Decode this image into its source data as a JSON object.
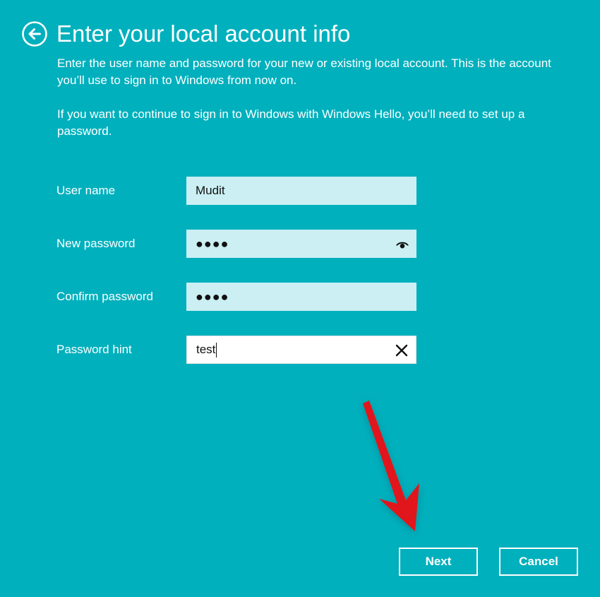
{
  "page": {
    "title": "Enter your local account info",
    "description": "Enter the user name and password for your new or existing local account. This is the account you’ll use to sign in to Windows from now on.",
    "hello_note": "If you want to continue to sign in to Windows with Windows Hello, you’ll need to set up a password."
  },
  "form": {
    "username": {
      "label": "User name",
      "value": "Mudit"
    },
    "new_password": {
      "label": "New password",
      "value": "●●●●"
    },
    "confirm_password": {
      "label": "Confirm password",
      "value": "●●●●"
    },
    "password_hint": {
      "label": "Password hint",
      "value": "test"
    }
  },
  "buttons": {
    "next": "Next",
    "cancel": "Cancel"
  },
  "icons": {
    "back": "back-arrow-icon",
    "reveal": "eye-icon",
    "clear": "close-icon"
  },
  "colors": {
    "background": "#01b0bd",
    "field_fill": "#cbeff3",
    "field_focused": "#ffffff",
    "text": "#ffffff",
    "annotation_arrow": "#e0161c"
  }
}
